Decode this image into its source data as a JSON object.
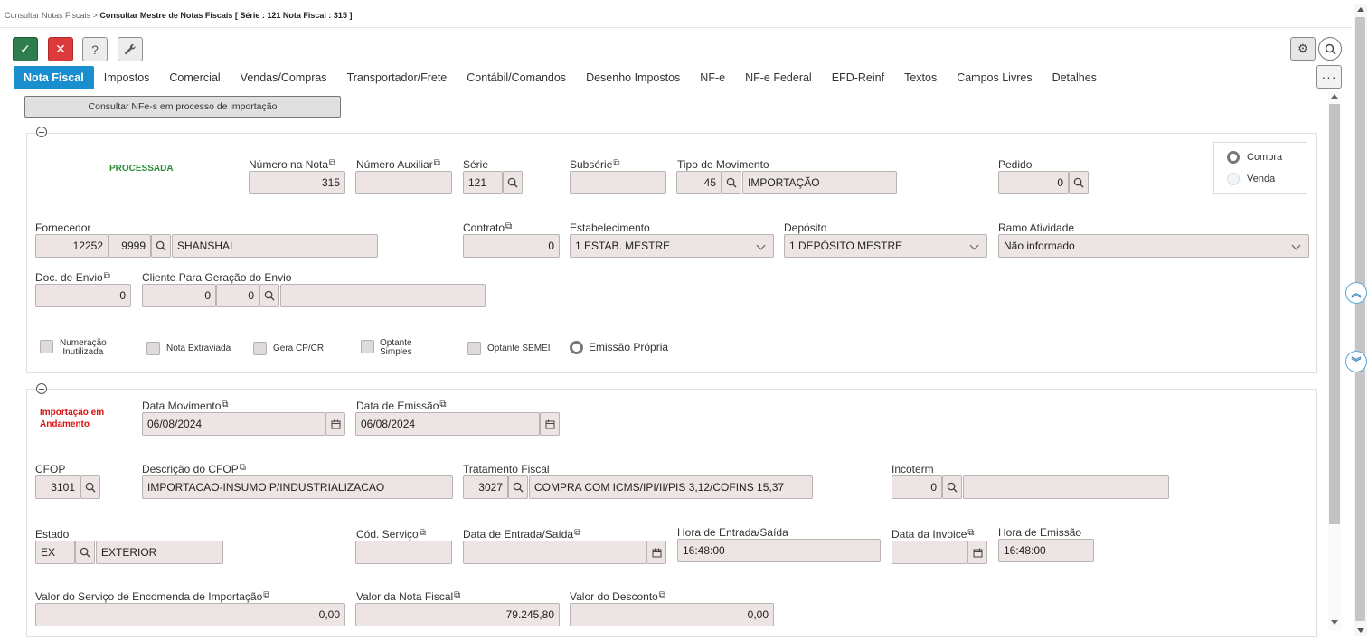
{
  "breadcrumb": {
    "root": "Consultar Notas Fiscais",
    "separator": ">",
    "current": "Consultar Mestre de Notas Fiscais [ Série : 121 Nota Fiscal : 315 ]"
  },
  "toolbar": {
    "confirm_icon": "✓",
    "cancel_icon": "✕",
    "help_icon": "?",
    "tools_icon": "🔧",
    "settings_icon": "⚙",
    "more_icon": "···"
  },
  "tabs": [
    {
      "label": "Nota Fiscal",
      "active": true
    },
    {
      "label": "Impostos"
    },
    {
      "label": "Comercial"
    },
    {
      "label": "Vendas/Compras"
    },
    {
      "label": "Transportador/Frete"
    },
    {
      "label": "Contábil/Comandos"
    },
    {
      "label": "Desenho Impostos"
    },
    {
      "label": "NF-e"
    },
    {
      "label": "NF-e Federal"
    },
    {
      "label": "EFD-Reinf"
    },
    {
      "label": "Textos"
    },
    {
      "label": "Campos Livres"
    },
    {
      "label": "Detalhes"
    }
  ],
  "import_button": "Consultar NFe-s em processo de importação",
  "section1": {
    "status": "PROCESSADA",
    "numero_nota": {
      "label": "Número na Nota",
      "value": "315"
    },
    "numero_auxiliar": {
      "label": "Número Auxiliar",
      "value": ""
    },
    "serie": {
      "label": "Série",
      "value": "121"
    },
    "subserie": {
      "label": "Subsérie",
      "value": ""
    },
    "tipo_movimento": {
      "label": "Tipo de Movimento",
      "code": "45",
      "desc": "IMPORTAÇÃO"
    },
    "pedido": {
      "label": "Pedido",
      "value": "0"
    },
    "tipo_radio": {
      "compra": "Compra",
      "venda": "Venda",
      "selected": "Compra"
    },
    "fornecedor": {
      "label": "Fornecedor",
      "code": "12252",
      "sub": "9999",
      "name": "SHANSHAI"
    },
    "contrato": {
      "label": "Contrato",
      "value": "0"
    },
    "estabelecimento": {
      "label": "Estabelecimento",
      "value": "1 ESTAB. MESTRE"
    },
    "deposito": {
      "label": "Depósito",
      "value": "1 DEPÓSITO MESTRE"
    },
    "ramo": {
      "label": "Ramo Atividade",
      "value": "Não informado"
    },
    "doc_envio": {
      "label": "Doc. de Envio",
      "value": "0"
    },
    "cliente_envio": {
      "label": "Cliente Para Geração do Envio",
      "code": "0",
      "sub": "0",
      "name": ""
    },
    "checks": {
      "numeracao_1": "Numeração",
      "numeracao_2": "Inutilizada",
      "extraviada": "Nota Extraviada",
      "gera_cp": "Gera CP/CR",
      "optante_1": "Optante",
      "optante_2": "Simples",
      "semei": "Optante SEMEI",
      "emissao_propria": "Emissão Própria"
    }
  },
  "section2": {
    "status_line1": "Importação em",
    "status_line2": "Andamento",
    "data_movimento": {
      "label": "Data Movimento",
      "value": "06/08/2024"
    },
    "data_emissao": {
      "label": "Data de Emissão",
      "value": "06/08/2024"
    },
    "cfop": {
      "label": "CFOP",
      "value": "3101"
    },
    "descricao_cfop": {
      "label": "Descrição do CFOP",
      "value": "IMPORTACAO-INSUMO P/INDUSTRIALIZACAO"
    },
    "tratamento_fiscal": {
      "label": "Tratamento Fiscal",
      "code": "3027",
      "desc": "COMPRA COM ICMS/IPI/II/PIS 3,12/COFINS 15,37"
    },
    "incoterm": {
      "label": "Incoterm",
      "code": "0",
      "desc": ""
    },
    "estado": {
      "label": "Estado",
      "code": "EX",
      "desc": "EXTERIOR"
    },
    "cod_servico": {
      "label": "Cód. Serviço",
      "value": ""
    },
    "data_entrada": {
      "label": "Data de Entrada/Saída",
      "value": ""
    },
    "hora_entrada": {
      "label": "Hora de Entrada/Saída",
      "value": "16:48:00"
    },
    "data_invoice": {
      "label": "Data da Invoice",
      "value": ""
    },
    "hora_emissao": {
      "label": "Hora de Emissão",
      "value": "16:48:00"
    },
    "valor_servico": {
      "label": "Valor do Serviço de Encomenda de Importação",
      "value": "0,00"
    },
    "valor_nota": {
      "label": "Valor da Nota Fiscal",
      "value": "79.245,80"
    },
    "valor_desconto": {
      "label": "Valor do Desconto",
      "value": "0,00"
    }
  },
  "colors": {
    "accent": "#1a8fd0",
    "confirm": "#2e7d4f",
    "cancel": "#dd3b3b",
    "status_ok": "#2e8b3a",
    "status_warn": "#dd1111",
    "field_bg": "#ede4e4"
  }
}
